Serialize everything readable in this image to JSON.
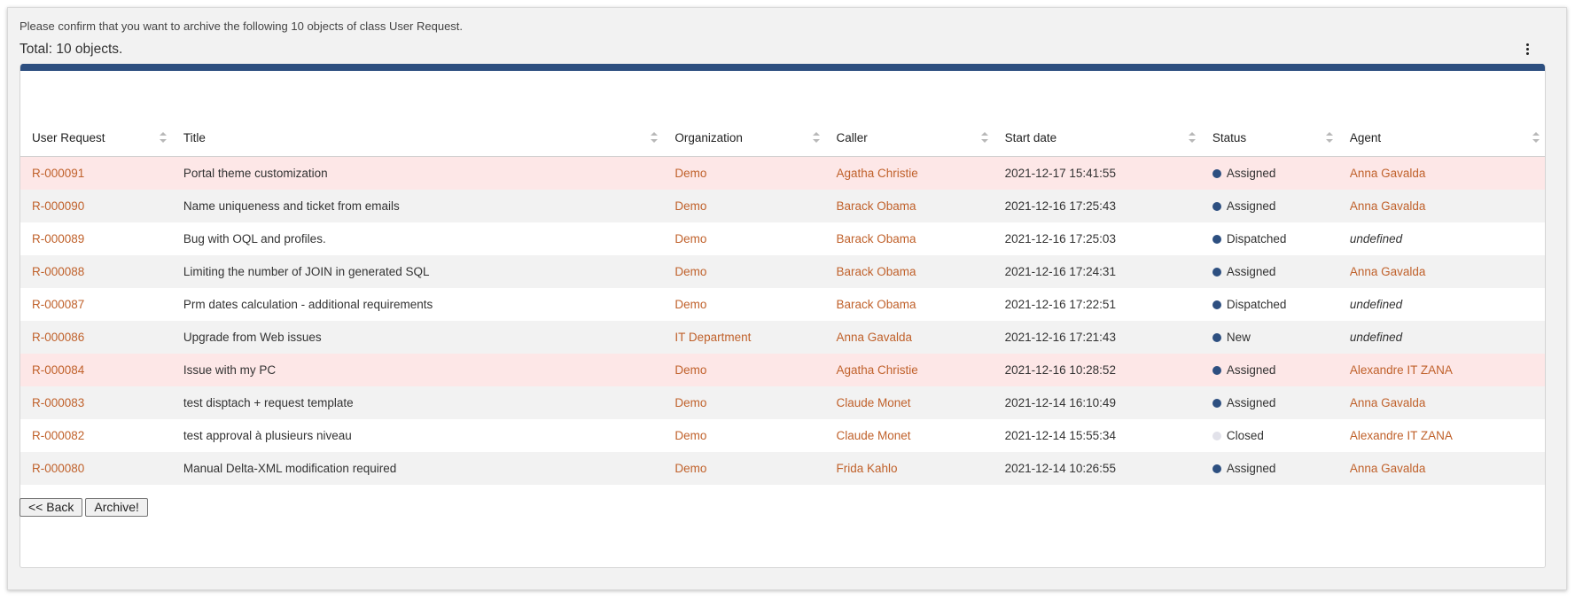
{
  "header": {
    "confirm_message": "Please confirm that you want to archive the following 10 objects of class User Request.",
    "total": "Total: 10 objects."
  },
  "colors": {
    "accent_bar": "#2d4f80",
    "link": "#c0612b",
    "row_highlight": "#fde7e7",
    "status_active_dot": "#2d4f80",
    "status_closed_dot": "#e2e2ea"
  },
  "table": {
    "columns": [
      "User Request",
      "Title",
      "Organization",
      "Caller",
      "Start date",
      "Status",
      "Agent"
    ],
    "rows": [
      {
        "ref": "R-000091",
        "title": "Portal theme customization",
        "org": "Demo",
        "caller": "Agatha Christie",
        "start": "2021-12-17 15:41:55",
        "status": "Assigned",
        "status_color": "#2d4f80",
        "agent": "Anna Gavalda",
        "agent_defined": true,
        "style": "pink"
      },
      {
        "ref": "R-000090",
        "title": "Name uniqueness and ticket from emails",
        "org": "Demo",
        "caller": "Barack Obama",
        "start": "2021-12-16 17:25:43",
        "status": "Assigned",
        "status_color": "#2d4f80",
        "agent": "Anna Gavalda",
        "agent_defined": true,
        "style": "grey"
      },
      {
        "ref": "R-000089",
        "title": "Bug with OQL and profiles.",
        "org": "Demo",
        "caller": "Barack Obama",
        "start": "2021-12-16 17:25:03",
        "status": "Dispatched",
        "status_color": "#2d4f80",
        "agent": "undefined",
        "agent_defined": false,
        "style": "white"
      },
      {
        "ref": "R-000088",
        "title": "Limiting the number of JOIN in generated SQL",
        "org": "Demo",
        "caller": "Barack Obama",
        "start": "2021-12-16 17:24:31",
        "status": "Assigned",
        "status_color": "#2d4f80",
        "agent": "Anna Gavalda",
        "agent_defined": true,
        "style": "grey"
      },
      {
        "ref": "R-000087",
        "title": "Prm dates calculation - additional requirements",
        "org": "Demo",
        "caller": "Barack Obama",
        "start": "2021-12-16 17:22:51",
        "status": "Dispatched",
        "status_color": "#2d4f80",
        "agent": "undefined",
        "agent_defined": false,
        "style": "white"
      },
      {
        "ref": "R-000086",
        "title": "Upgrade from Web issues",
        "org": "IT Department",
        "caller": "Anna Gavalda",
        "start": "2021-12-16 17:21:43",
        "status": "New",
        "status_color": "#2d4f80",
        "agent": "undefined",
        "agent_defined": false,
        "style": "grey"
      },
      {
        "ref": "R-000084",
        "title": "Issue with my PC",
        "org": "Demo",
        "caller": "Agatha Christie",
        "start": "2021-12-16 10:28:52",
        "status": "Assigned",
        "status_color": "#2d4f80",
        "agent": "Alexandre IT ZANA",
        "agent_defined": true,
        "style": "pink"
      },
      {
        "ref": "R-000083",
        "title": "test disptach + request template",
        "org": "Demo",
        "caller": "Claude Monet",
        "start": "2021-12-14 16:10:49",
        "status": "Assigned",
        "status_color": "#2d4f80",
        "agent": "Anna Gavalda",
        "agent_defined": true,
        "style": "grey"
      },
      {
        "ref": "R-000082",
        "title": "test approval à plusieurs niveau",
        "org": "Demo",
        "caller": "Claude Monet",
        "start": "2021-12-14 15:55:34",
        "status": "Closed",
        "status_color": "#e2e2ea",
        "agent": "Alexandre IT ZANA",
        "agent_defined": true,
        "style": "white"
      },
      {
        "ref": "R-000080",
        "title": "Manual Delta-XML modification required",
        "org": "Demo",
        "caller": "Frida Kahlo",
        "start": "2021-12-14 10:26:55",
        "status": "Assigned",
        "status_color": "#2d4f80",
        "agent": "Anna Gavalda",
        "agent_defined": true,
        "style": "grey"
      }
    ]
  },
  "actions": {
    "back_label": "<< Back",
    "archive_label": "Archive!"
  }
}
